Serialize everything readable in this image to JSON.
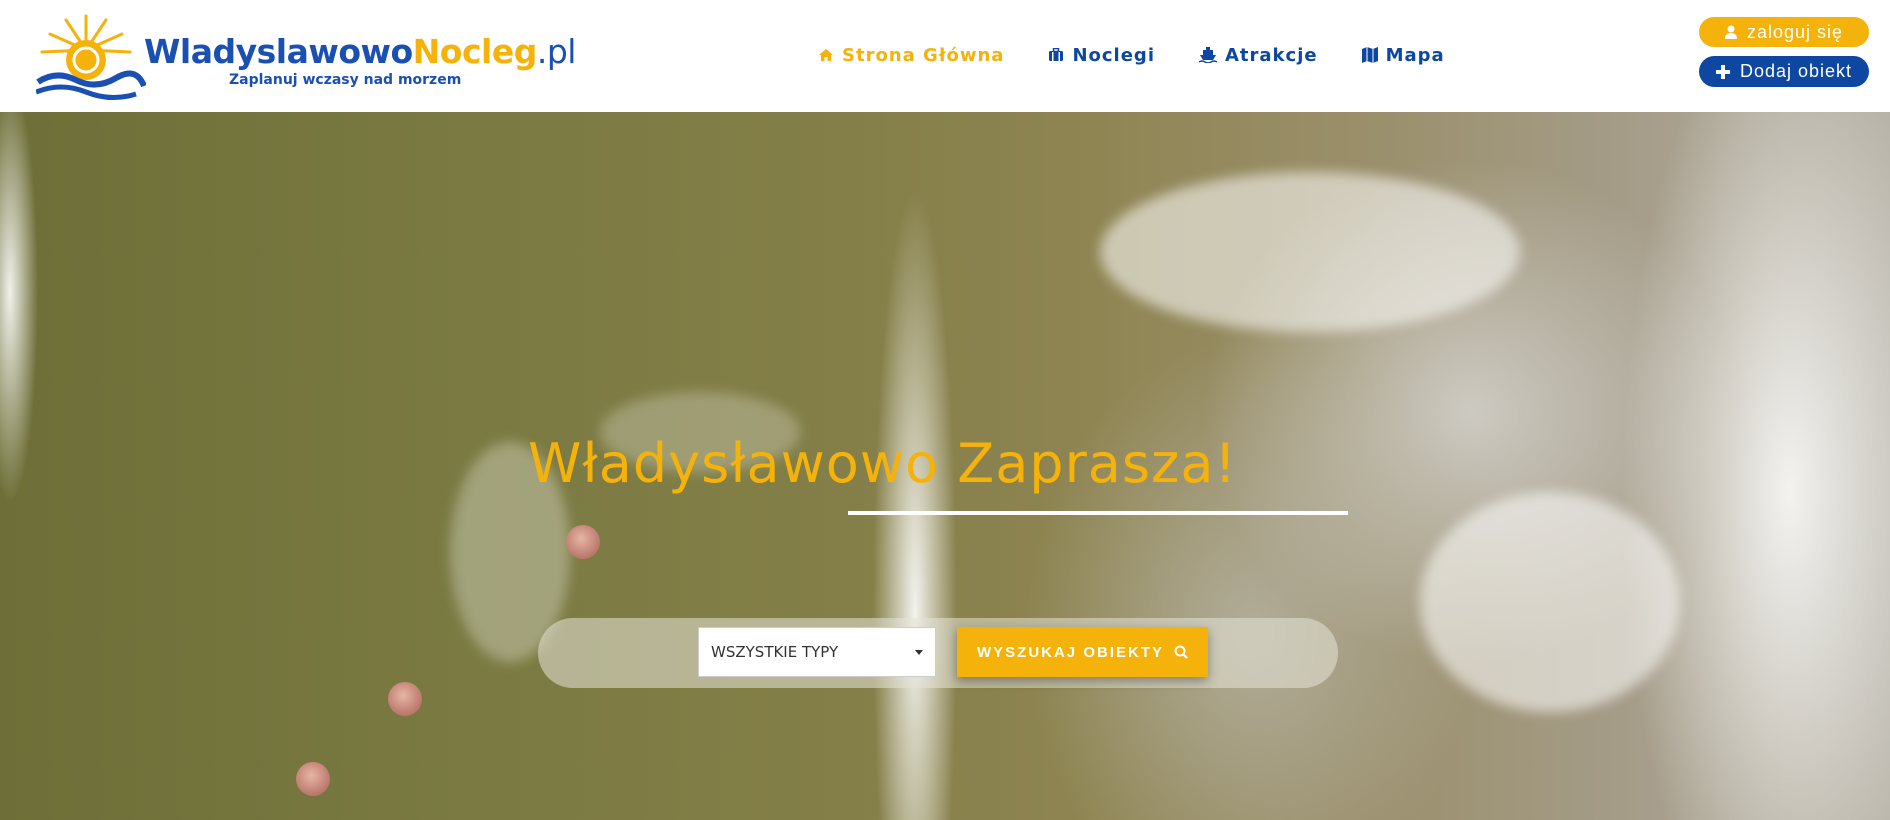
{
  "logo": {
    "part1": "Wladyslawowo",
    "part2": "Nocleg",
    "part3": ".pl",
    "tagline": "Zaplanuj wczasy nad morzem"
  },
  "nav": {
    "items": [
      {
        "label": "Strona Główna",
        "icon": "home-icon"
      },
      {
        "label": "Noclegi",
        "icon": "suitcase-icon"
      },
      {
        "label": "Atrakcje",
        "icon": "ship-icon"
      },
      {
        "label": "Mapa",
        "icon": "map-icon"
      }
    ]
  },
  "account": {
    "login_label": "zaloguj się",
    "add_label": "Dodaj obiekt"
  },
  "hero": {
    "title": "Władysławowo Zaprasza!"
  },
  "search": {
    "type_value": "WSZYSTKIE TYPY",
    "button_label": "WYSZUKAJ OBIEKTY"
  },
  "colors": {
    "accent_yellow": "#f5b20b",
    "brand_blue": "#0d47a1"
  }
}
